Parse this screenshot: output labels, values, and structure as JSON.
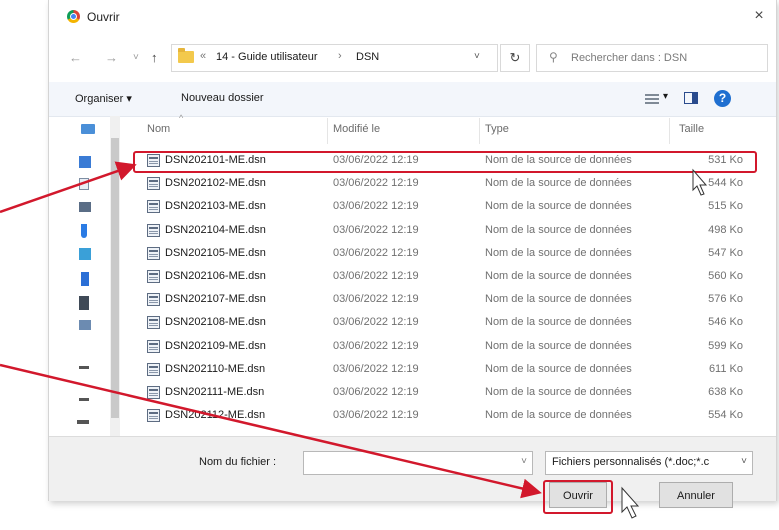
{
  "window": {
    "title": "Ouvrir",
    "close_label": "×"
  },
  "nav": {
    "back": "←",
    "forward": "→",
    "recent": "˅",
    "up": "↑",
    "crumb_prefix": "«",
    "breadcrumbs": [
      "14 - Guide utilisateur",
      "DSN"
    ],
    "crumb_separator": "›",
    "address_dropdown": "˅",
    "refresh": "↻",
    "search_placeholder": "Rechercher dans : DSN"
  },
  "toolbar": {
    "organize_label": "Organiser ▾",
    "new_folder_label": "Nouveau dossier",
    "view_dropdown": "▾",
    "help_label": "?"
  },
  "columns": {
    "name": "Nom",
    "modified": "Modifié le",
    "type": "Type",
    "size": "Taille"
  },
  "files": [
    {
      "name": "DSN202101-ME.dsn",
      "modified": "03/06/2022 12:19",
      "type": "Nom de la source de données",
      "size": "531 Ko"
    },
    {
      "name": "DSN202102-ME.dsn",
      "modified": "03/06/2022 12:19",
      "type": "Nom de la source de données",
      "size": "544 Ko"
    },
    {
      "name": "DSN202103-ME.dsn",
      "modified": "03/06/2022 12:19",
      "type": "Nom de la source de données",
      "size": "515 Ko"
    },
    {
      "name": "DSN202104-ME.dsn",
      "modified": "03/06/2022 12:19",
      "type": "Nom de la source de données",
      "size": "498 Ko"
    },
    {
      "name": "DSN202105-ME.dsn",
      "modified": "03/06/2022 12:19",
      "type": "Nom de la source de données",
      "size": "547 Ko"
    },
    {
      "name": "DSN202106-ME.dsn",
      "modified": "03/06/2022 12:19",
      "type": "Nom de la source de données",
      "size": "560 Ko"
    },
    {
      "name": "DSN202107-ME.dsn",
      "modified": "03/06/2022 12:19",
      "type": "Nom de la source de données",
      "size": "576 Ko"
    },
    {
      "name": "DSN202108-ME.dsn",
      "modified": "03/06/2022 12:19",
      "type": "Nom de la source de données",
      "size": "546 Ko"
    },
    {
      "name": "DSN202109-ME.dsn",
      "modified": "03/06/2022 12:19",
      "type": "Nom de la source de données",
      "size": "599 Ko"
    },
    {
      "name": "DSN202110-ME.dsn",
      "modified": "03/06/2022 12:19",
      "type": "Nom de la source de données",
      "size": "611 Ko"
    },
    {
      "name": "DSN202111-ME.dsn",
      "modified": "03/06/2022 12:19",
      "type": "Nom de la source de données",
      "size": "638 Ko"
    },
    {
      "name": "DSN202112-ME.dsn",
      "modified": "03/06/2022 12:19",
      "type": "Nom de la source de données",
      "size": "554 Ko"
    }
  ],
  "footer": {
    "filename_label": "Nom du fichier :",
    "filename_value": "",
    "filter_value": "Fichiers personnalisés (*.doc;*.c",
    "open_label": "Ouvrir",
    "cancel_label": "Annuler"
  },
  "colors": {
    "annotation": "#d2182c",
    "accent": "#1f6fd0",
    "folder": "#f3c94c"
  }
}
